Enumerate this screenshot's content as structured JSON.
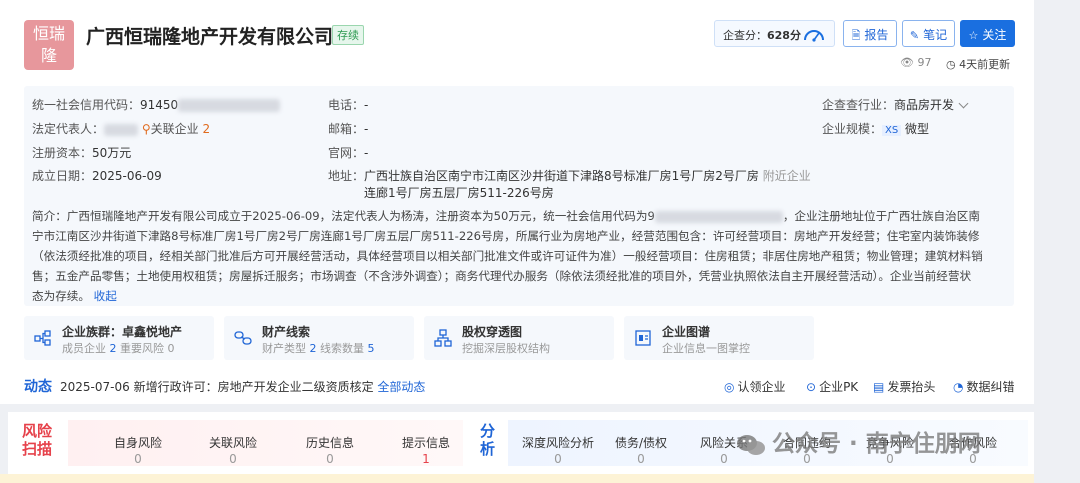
{
  "company": {
    "logo_text_line1": "恒瑞",
    "logo_text_line2": "隆",
    "name": "广西恒瑞隆地产开发有限公司",
    "status": "存续"
  },
  "header": {
    "score_label": "企查分：",
    "score_value": "628分",
    "report_label": "报告",
    "notes_label": "笔记",
    "follow_label": "关注",
    "views": "97",
    "updated": "4天前更新"
  },
  "info": {
    "credit_code_label": "统一社会信用代码：",
    "credit_code_visible": "91450",
    "legal_rep_label": "法定代表人：",
    "related_label": "关联企业",
    "related_count": "2",
    "capital_label": "注册资本：",
    "capital_value": "50万元",
    "founded_label": "成立日期：",
    "founded_value": "2025-06-09",
    "phone_label": "电话：",
    "phone_value": "-",
    "email_label": "邮箱：",
    "email_value": "-",
    "website_label": "官网：",
    "website_value": "-",
    "address_label": "地址：",
    "address_line1": "广西壮族自治区南宁市江南区沙井街道下津路8号标准厂房1号厂房2号厂房",
    "address_line2": "连廊1号厂房五层厂房511-226号房",
    "nearby_label": "附近企业",
    "industry_label": "企查查行业：",
    "industry_value": "商品房开发",
    "scale_label": "企业规模：",
    "scale_tag": "XS",
    "scale_value": "微型"
  },
  "description": {
    "line1a": "简介：广西恒瑞隆地产开发有限公司成立于2025-06-09，法定代表人为杨涛，注册资本为50万元，统一社会信用代码为9",
    "line1b": "，企业注册地址位于广西壮族自治区南",
    "line2": "宁市江南区沙井街道下津路8号标准厂房1号厂房2号厂房连廊1号厂房五层厂房511-226号房，所属行业为房地产业，经营范围包含：许可经营项目：房地产开发经营；住宅室内装饰装修",
    "line3": "（依法须经批准的项目，经相关部门批准后方可开展经营活动，具体经营项目以相关部门批准文件或许可证件为准）一般经营项目：住房租赁；非居住房地产租赁；物业管理；建筑材料销",
    "line4": "售；五金产品零售；土地使用权租赁；房屋拆迁服务；市场调查（不含涉外调查）；商务代理代办服务（除依法须经批准的项目外，凭营业执照依法自主开展经营活动）。企业当前经营状",
    "line5": "态为存续。",
    "collapse": "收起"
  },
  "tiles": [
    {
      "title": "企业族群：卓鑫悦地产",
      "sub1": "成员企业",
      "v1": "2",
      "sub2": "重要风险",
      "v2": "0"
    },
    {
      "title": "财产线索",
      "sub1": "财产类型",
      "v1": "2",
      "sub2": "线索数量",
      "v2": "5"
    },
    {
      "title": "股权穿透图",
      "sub1": "挖掘深层股权结构",
      "v1": "",
      "sub2": "",
      "v2": ""
    },
    {
      "title": "企业图谱",
      "sub1": "企业信息一图掌控",
      "v1": "",
      "sub2": "",
      "v2": ""
    }
  ],
  "dynamics": {
    "title": "动态",
    "date": "2025-07-06",
    "text": "新增行政许可：房地产开发企业二级资质核定",
    "all_link": "全部动态",
    "actions": [
      "认领企业",
      "企业PK",
      "发票抬头",
      "数据纠错"
    ]
  },
  "risk": {
    "tag_line1": "风险",
    "tag_line2": "扫描",
    "items": [
      {
        "label": "自身风险",
        "value": "0"
      },
      {
        "label": "关联风险",
        "value": "0"
      },
      {
        "label": "历史信息",
        "value": "0"
      },
      {
        "label": "提示信息",
        "value": "1"
      }
    ]
  },
  "analysis": {
    "tag_line1": "分",
    "tag_line2": "析",
    "items": [
      {
        "label": "深度风险分析",
        "value": "0"
      },
      {
        "label": "债务/债权",
        "value": "0"
      },
      {
        "label": "风险关系",
        "value": "0"
      },
      {
        "label": "合同违约",
        "value": "0"
      },
      {
        "label": "竞争风险",
        "value": "0"
      },
      {
        "label": "合作风险",
        "value": "0"
      }
    ]
  },
  "watermark": "公众号 · 南宁住朋网",
  "colors": {
    "accent": "#1a6fe0",
    "logo_bg": "#e7979c",
    "status_green": "#2e9a52",
    "risk_red": "#e6424b"
  }
}
